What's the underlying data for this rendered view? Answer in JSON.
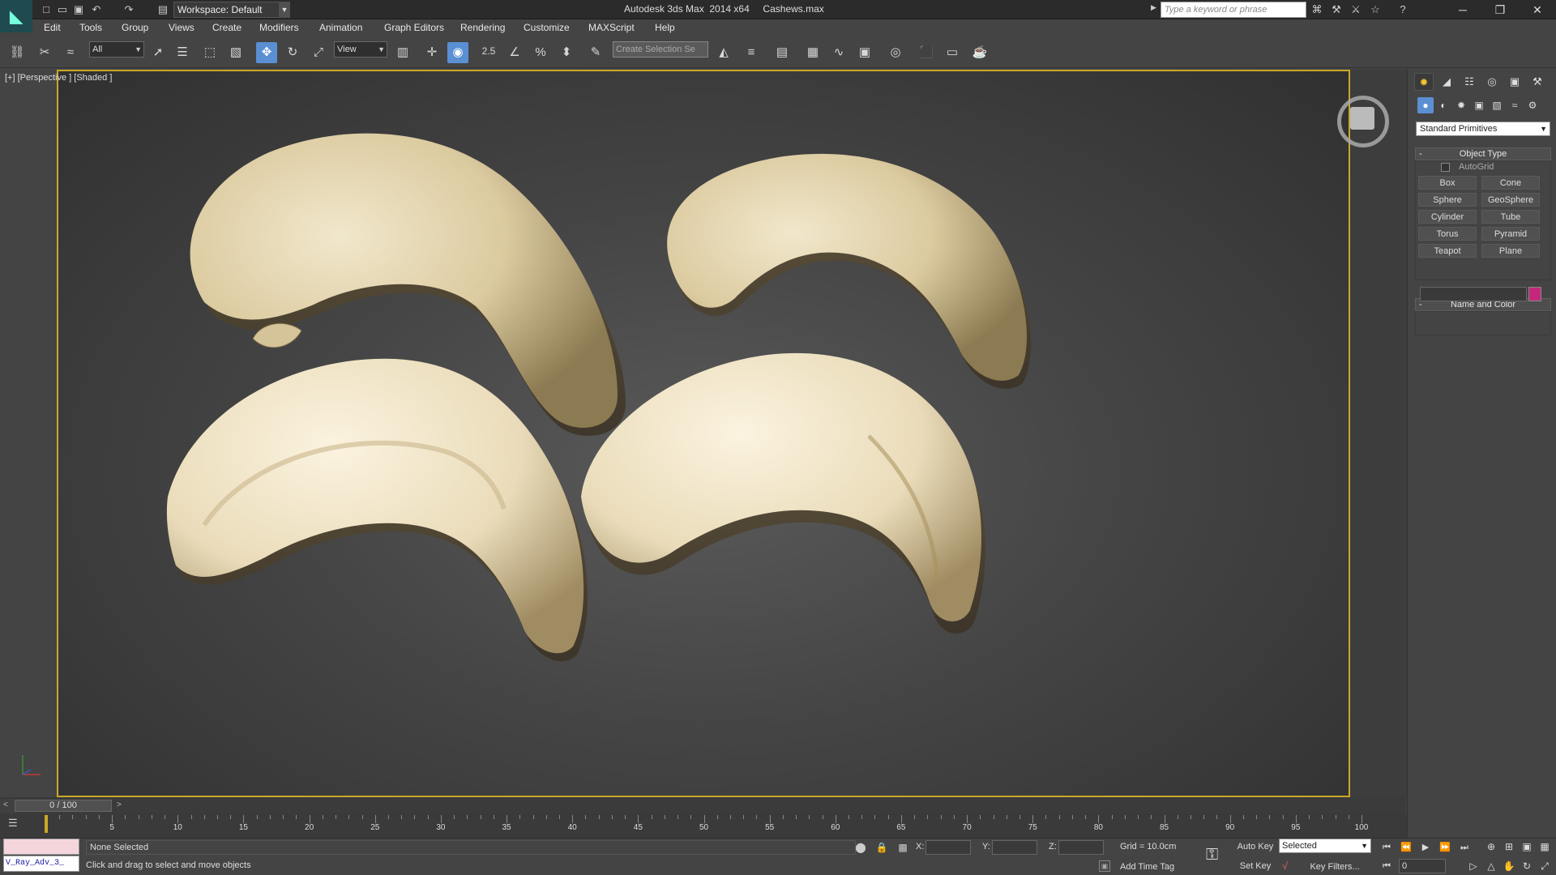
{
  "title_bar": {
    "app_title": "Autodesk 3ds Max  2014 x64     Cashews.max",
    "workspace_label": "Workspace: Default",
    "search_placeholder": "Type a keyword or phrase",
    "quick_access_icons": [
      "new-file-icon",
      "open-file-icon",
      "save-file-icon",
      "undo-icon",
      "redo-icon",
      "project-folder-icon"
    ],
    "help_icons": [
      "binoculars-icon",
      "key-icon",
      "tools-icon",
      "star-icon",
      "help-icon"
    ],
    "window_controls": {
      "minimize": "─",
      "maximize": "❐",
      "close": "✕"
    }
  },
  "menu": {
    "items": [
      "Edit",
      "Tools",
      "Group",
      "Views",
      "Create",
      "Modifiers",
      "Animation",
      "Graph Editors",
      "Rendering",
      "Customize",
      "MAXScript",
      "Help"
    ]
  },
  "toolbar": {
    "selection_filter": "All",
    "ref_coord": "View",
    "snap_value": "2.5",
    "selection_set_placeholder": "Create Selection Se",
    "active_tool": "select-and-move"
  },
  "viewport": {
    "label": "[+] [Perspective ] [Shaded ]",
    "border_color": "#c9a82a"
  },
  "command_panel": {
    "primitives_dropdown": "Standard Primitives",
    "object_type": {
      "title": "Object Type",
      "autogrid_label": "AutoGrid",
      "autogrid_checked": false,
      "buttons": [
        "Box",
        "Cone",
        "Sphere",
        "GeoSphere",
        "Cylinder",
        "Tube",
        "Torus",
        "Pyramid",
        "Teapot",
        "Plane"
      ]
    },
    "name_and_color": {
      "title": "Name and Color",
      "name_value": "",
      "color": "#c4287c"
    }
  },
  "timeline": {
    "frame_display": "0 / 100",
    "prev_arrow": "<",
    "next_arrow": ">",
    "ticks": [
      "5",
      "10",
      "15",
      "20",
      "25",
      "30",
      "35",
      "40",
      "45",
      "50",
      "55",
      "60",
      "65",
      "70",
      "75",
      "80",
      "85",
      "90",
      "95",
      "100"
    ]
  },
  "status": {
    "maxscript_listener": "V_Ray_Adv_3_",
    "selection_info": "None Selected",
    "prompt": "Click and drag to select and move objects",
    "coord_labels": {
      "x": "X:",
      "y": "Y:",
      "z": "Z:"
    },
    "grid": "Grid = 10.0cm",
    "add_time_tag": "Add Time Tag",
    "auto_key": "Auto Key",
    "set_key": "Set Key",
    "key_mode_select": "Selected",
    "key_filters": "Key Filters...",
    "current_frame": "0"
  },
  "colors": {
    "accent": "#5b8fd3",
    "viewport_border": "#c9a82a",
    "cashew_base": "#e8dcc0"
  }
}
